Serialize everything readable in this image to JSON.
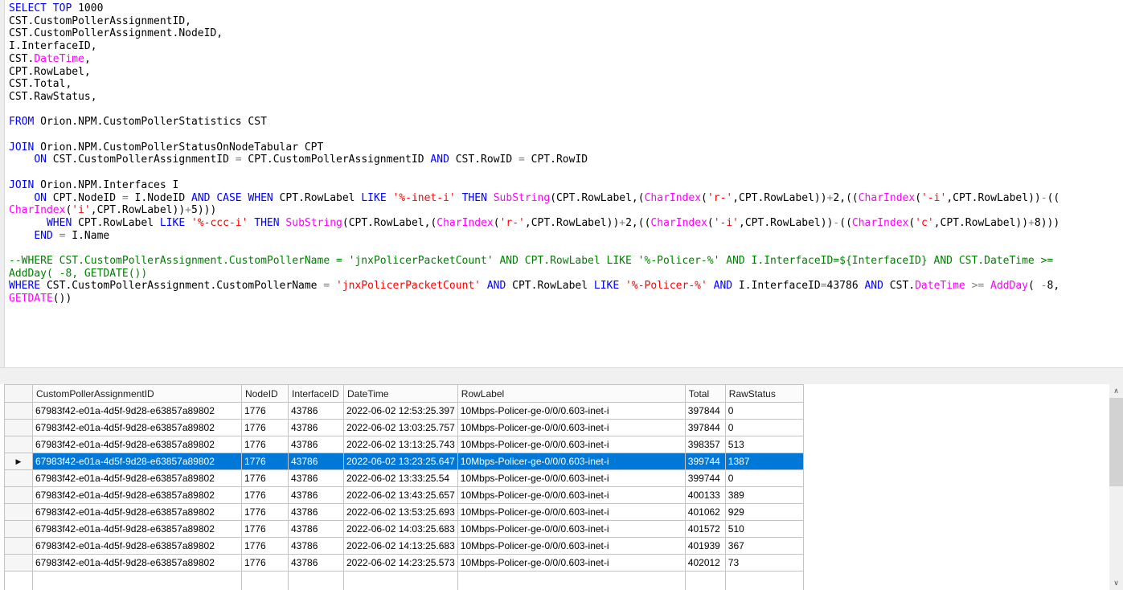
{
  "colors": {
    "keyword": "#0000ff",
    "builtin_function": "#ff00ff",
    "string_literal": "#ff0000",
    "comment": "#008000",
    "operator": "#808080",
    "plain_text": "#000000",
    "selected_row_bg": "#0078d7",
    "selected_row_fg": "#ffffff"
  },
  "editor": {
    "code_lines": [
      [
        [
          "k",
          "SELECT"
        ],
        [
          "n",
          " "
        ],
        [
          "k",
          "TOP"
        ],
        [
          "n",
          " 1000"
        ]
      ],
      [
        [
          "n",
          "CST.CustomPollerAssignmentID,"
        ]
      ],
      [
        [
          "n",
          "CST.CustomPollerAssignment.NodeID,"
        ]
      ],
      [
        [
          "n",
          "I.InterfaceID,"
        ]
      ],
      [
        [
          "n",
          "CST."
        ],
        [
          "f",
          "DateTime"
        ],
        [
          "n",
          ","
        ]
      ],
      [
        [
          "n",
          "CPT.RowLabel,"
        ]
      ],
      [
        [
          "n",
          "CST.Total,"
        ]
      ],
      [
        [
          "n",
          "CST.RawStatus,"
        ]
      ],
      [],
      [
        [
          "k",
          "FROM"
        ],
        [
          "n",
          " Orion.NPM.CustomPollerStatistics CST"
        ]
      ],
      [],
      [
        [
          "k",
          "JOIN"
        ],
        [
          "n",
          " Orion.NPM.CustomPollerStatusOnNodeTabular CPT"
        ]
      ],
      [
        [
          "n",
          "    "
        ],
        [
          "k",
          "ON"
        ],
        [
          "n",
          " CST.CustomPollerAssignmentID "
        ],
        [
          "o",
          "="
        ],
        [
          "n",
          " CPT.CustomPollerAssignmentID "
        ],
        [
          "k",
          "AND"
        ],
        [
          "n",
          " CST.RowID "
        ],
        [
          "o",
          "="
        ],
        [
          "n",
          " CPT.RowID"
        ]
      ],
      [],
      [
        [
          "k",
          "JOIN"
        ],
        [
          "n",
          " Orion.NPM.Interfaces I"
        ]
      ],
      [
        [
          "n",
          "    "
        ],
        [
          "k",
          "ON"
        ],
        [
          "n",
          " CPT.NodeID "
        ],
        [
          "o",
          "="
        ],
        [
          "n",
          " I.NodeID "
        ],
        [
          "k",
          "AND"
        ],
        [
          "n",
          " "
        ],
        [
          "k",
          "CASE"
        ],
        [
          "n",
          " "
        ],
        [
          "k",
          "WHEN"
        ],
        [
          "n",
          " CPT.RowLabel "
        ],
        [
          "k",
          "LIKE"
        ],
        [
          "n",
          " "
        ],
        [
          "s",
          "'%-inet-i'"
        ],
        [
          "n",
          " "
        ],
        [
          "k",
          "THEN"
        ],
        [
          "n",
          " "
        ],
        [
          "f",
          "SubString"
        ],
        [
          "n",
          "(CPT.RowLabel,("
        ],
        [
          "f",
          "CharIndex"
        ],
        [
          "n",
          "("
        ],
        [
          "s",
          "'r-'"
        ],
        [
          "n",
          ",CPT.RowLabel))"
        ],
        [
          "o",
          "+"
        ],
        [
          "n",
          "2,(("
        ],
        [
          "f",
          "CharIndex"
        ],
        [
          "n",
          "("
        ],
        [
          "s",
          "'-i'"
        ],
        [
          "n",
          ",CPT.RowLabel))"
        ],
        [
          "o",
          "-"
        ],
        [
          "n",
          "(("
        ]
      ],
      [
        [
          "f",
          "CharIndex"
        ],
        [
          "n",
          "("
        ],
        [
          "s",
          "'i'"
        ],
        [
          "n",
          ",CPT.RowLabel))"
        ],
        [
          "o",
          "+"
        ],
        [
          "n",
          "5)))"
        ]
      ],
      [
        [
          "n",
          "      "
        ],
        [
          "k",
          "WHEN"
        ],
        [
          "n",
          " CPT.RowLabel "
        ],
        [
          "k",
          "LIKE"
        ],
        [
          "n",
          " "
        ],
        [
          "s",
          "'%-ccc-i'"
        ],
        [
          "n",
          " "
        ],
        [
          "k",
          "THEN"
        ],
        [
          "n",
          " "
        ],
        [
          "f",
          "SubString"
        ],
        [
          "n",
          "(CPT.RowLabel,("
        ],
        [
          "f",
          "CharIndex"
        ],
        [
          "n",
          "("
        ],
        [
          "s",
          "'r-'"
        ],
        [
          "n",
          ",CPT.RowLabel))"
        ],
        [
          "o",
          "+"
        ],
        [
          "n",
          "2,(("
        ],
        [
          "f",
          "CharIndex"
        ],
        [
          "n",
          "("
        ],
        [
          "s",
          "'-i'"
        ],
        [
          "n",
          ",CPT.RowLabel))"
        ],
        [
          "o",
          "-"
        ],
        [
          "n",
          "(("
        ],
        [
          "f",
          "CharIndex"
        ],
        [
          "n",
          "("
        ],
        [
          "s",
          "'c'"
        ],
        [
          "n",
          ",CPT.RowLabel))"
        ],
        [
          "o",
          "+"
        ],
        [
          "n",
          "8)))"
        ]
      ],
      [
        [
          "n",
          "    "
        ],
        [
          "k",
          "END"
        ],
        [
          "n",
          " "
        ],
        [
          "o",
          "="
        ],
        [
          "n",
          " I.Name"
        ]
      ],
      [],
      [
        [
          "c",
          "--WHERE CST.CustomPollerAssignment.CustomPollerName = 'jnxPolicerPacketCount' AND CPT.RowLabel LIKE '%-Policer-%' AND I.InterfaceID=${InterfaceID} AND CST.DateTime >="
        ]
      ],
      [
        [
          "c",
          "AddDay( -8, GETDATE())"
        ]
      ],
      [
        [
          "k",
          "WHERE"
        ],
        [
          "n",
          " CST.CustomPollerAssignment.CustomPollerName "
        ],
        [
          "o",
          "="
        ],
        [
          "n",
          " "
        ],
        [
          "s",
          "'jnxPolicerPacketCount'"
        ],
        [
          "n",
          " "
        ],
        [
          "k",
          "AND"
        ],
        [
          "n",
          " CPT.RowLabel "
        ],
        [
          "k",
          "LIKE"
        ],
        [
          "n",
          " "
        ],
        [
          "s",
          "'%-Policer-%'"
        ],
        [
          "n",
          " "
        ],
        [
          "k",
          "AND"
        ],
        [
          "n",
          " I.InterfaceID"
        ],
        [
          "o",
          "="
        ],
        [
          "n",
          "43786 "
        ],
        [
          "k",
          "AND"
        ],
        [
          "n",
          " CST."
        ],
        [
          "f",
          "DateTime"
        ],
        [
          "n",
          " "
        ],
        [
          "o",
          ">="
        ],
        [
          "n",
          " "
        ],
        [
          "f",
          "AddDay"
        ],
        [
          "n",
          "( "
        ],
        [
          "o",
          "-"
        ],
        [
          "n",
          "8,"
        ]
      ],
      [
        [
          "f",
          "GETDATE"
        ],
        [
          "n",
          "())"
        ]
      ]
    ]
  },
  "results_grid": {
    "columns": [
      "CustomPollerAssignmentID",
      "NodeID",
      "InterfaceID",
      "DateTime",
      "RowLabel",
      "Total",
      "RawStatus"
    ],
    "rows": [
      [
        "67983f42-e01a-4d5f-9d28-e63857a89802",
        "1776",
        "43786",
        "2022-06-02 12:53:25.397",
        "10Mbps-Policer-ge-0/0/0.603-inet-i",
        "397844",
        "0"
      ],
      [
        "67983f42-e01a-4d5f-9d28-e63857a89802",
        "1776",
        "43786",
        "2022-06-02 13:03:25.757",
        "10Mbps-Policer-ge-0/0/0.603-inet-i",
        "397844",
        "0"
      ],
      [
        "67983f42-e01a-4d5f-9d28-e63857a89802",
        "1776",
        "43786",
        "2022-06-02 13:13:25.743",
        "10Mbps-Policer-ge-0/0/0.603-inet-i",
        "398357",
        "513"
      ],
      [
        "67983f42-e01a-4d5f-9d28-e63857a89802",
        "1776",
        "43786",
        "2022-06-02 13:23:25.647",
        "10Mbps-Policer-ge-0/0/0.603-inet-i",
        "399744",
        "1387"
      ],
      [
        "67983f42-e01a-4d5f-9d28-e63857a89802",
        "1776",
        "43786",
        "2022-06-02 13:33:25.54",
        "10Mbps-Policer-ge-0/0/0.603-inet-i",
        "399744",
        "0"
      ],
      [
        "67983f42-e01a-4d5f-9d28-e63857a89802",
        "1776",
        "43786",
        "2022-06-02 13:43:25.657",
        "10Mbps-Policer-ge-0/0/0.603-inet-i",
        "400133",
        "389"
      ],
      [
        "67983f42-e01a-4d5f-9d28-e63857a89802",
        "1776",
        "43786",
        "2022-06-02 13:53:25.693",
        "10Mbps-Policer-ge-0/0/0.603-inet-i",
        "401062",
        "929"
      ],
      [
        "67983f42-e01a-4d5f-9d28-e63857a89802",
        "1776",
        "43786",
        "2022-06-02 14:03:25.683",
        "10Mbps-Policer-ge-0/0/0.603-inet-i",
        "401572",
        "510"
      ],
      [
        "67983f42-e01a-4d5f-9d28-e63857a89802",
        "1776",
        "43786",
        "2022-06-02 14:13:25.683",
        "10Mbps-Policer-ge-0/0/0.603-inet-i",
        "401939",
        "367"
      ],
      [
        "67983f42-e01a-4d5f-9d28-e63857a89802",
        "1776",
        "43786",
        "2022-06-02 14:23:25.573",
        "10Mbps-Policer-ge-0/0/0.603-inet-i",
        "402012",
        "73"
      ]
    ],
    "selected_row_index": 3,
    "row_marker": "▶"
  },
  "scrollbar": {
    "up_icon": "∧",
    "down_icon": "∨"
  }
}
